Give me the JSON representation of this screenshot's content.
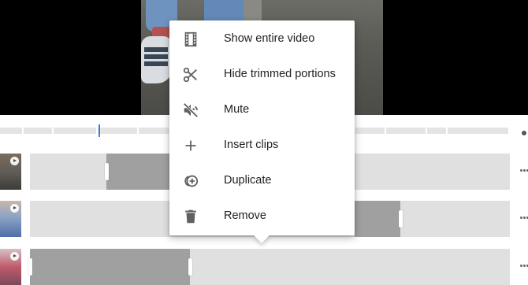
{
  "menu": {
    "items": [
      {
        "label": "Show entire video",
        "icon": "film-icon"
      },
      {
        "label": "Hide trimmed portions",
        "icon": "scissors-icon"
      },
      {
        "label": "Mute",
        "icon": "mute-icon"
      },
      {
        "label": "Insert clips",
        "icon": "plus-icon"
      },
      {
        "label": "Duplicate",
        "icon": "duplicate-icon"
      },
      {
        "label": "Remove",
        "icon": "trash-icon"
      }
    ]
  },
  "colors": {
    "playhead": "#3f7ee8",
    "clip_selected": "#a0a0a0",
    "clip_unselected": "#e0e0e0",
    "icon": "#616161"
  }
}
